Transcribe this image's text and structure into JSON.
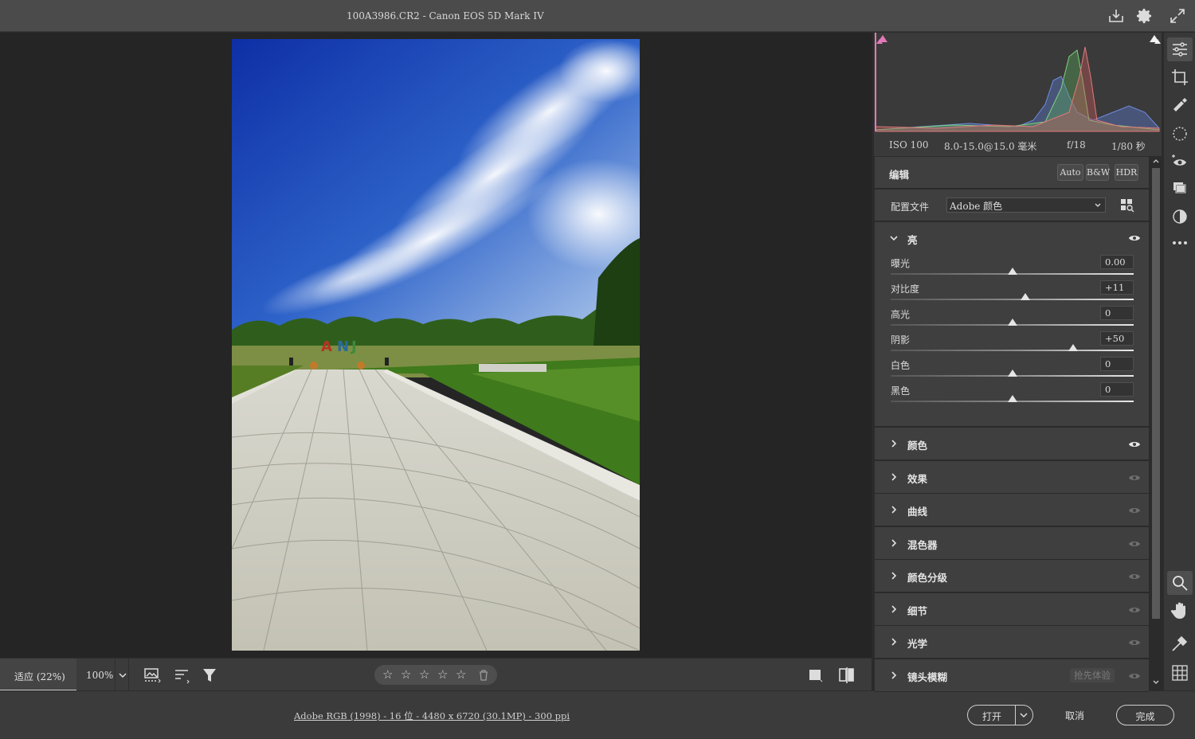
{
  "window": {
    "title": "100A3986.CR2 -  Canon EOS 5D Mark IV"
  },
  "bottom_bar": {
    "fit_label": "适应 (22%)",
    "zoom_value": "100%",
    "rating_stars": [
      "☆",
      "☆",
      "☆",
      "☆",
      "☆"
    ]
  },
  "status": {
    "workflow_info": "Adobe RGB (1998) - 16 位 - 4480 x 6720 (30.1MP) - 300 ppi",
    "open_label": "打开",
    "cancel_label": "取消",
    "done_label": "完成"
  },
  "exif": {
    "iso": "ISO 100",
    "focal": "8.0-15.0@15.0 毫米",
    "aperture": "f/18",
    "shutter": "1/80 秒"
  },
  "edit": {
    "title": "编辑",
    "auto_label": "Auto",
    "bw_label": "B&W",
    "hdr_label": "HDR",
    "profile_label": "配置文件",
    "profile_value": "Adobe 颜色"
  },
  "light": {
    "title": "亮",
    "sliders": [
      {
        "label": "曝光",
        "value": "0.00",
        "position": 0.5
      },
      {
        "label": "对比度",
        "value": "+11",
        "position": 0.555
      },
      {
        "label": "高光",
        "value": "0",
        "position": 0.5
      },
      {
        "label": "阴影",
        "value": "+50",
        "position": 0.75
      },
      {
        "label": "白色",
        "value": "0",
        "position": 0.5
      },
      {
        "label": "黑色",
        "value": "0",
        "position": 0.5
      }
    ]
  },
  "panels": [
    {
      "label": "颜色",
      "eye_active": true
    },
    {
      "label": "效果",
      "eye_active": false
    },
    {
      "label": "曲线",
      "eye_active": false
    },
    {
      "label": "混色器",
      "eye_active": false
    },
    {
      "label": "颜色分级",
      "eye_active": false
    },
    {
      "label": "细节",
      "eye_active": false
    },
    {
      "label": "光学",
      "eye_active": false
    },
    {
      "label": "镜头模糊",
      "eye_active": false,
      "badge": "抢先体验"
    }
  ],
  "tools": [
    "edit-sliders-icon",
    "crop-icon",
    "healing-icon",
    "masking-icon",
    "red-eye-icon",
    "presets-icon",
    "snapshot-icon",
    "more-icon",
    "zoom-icon",
    "hand-icon",
    "sampler-icon",
    "grid-icon"
  ],
  "colors": {
    "accent_pink": "#e07ab8",
    "panel_bg": "#3f3f3f",
    "sky_blue": "#1f4fb5",
    "grass_green": "#4f8a22"
  }
}
